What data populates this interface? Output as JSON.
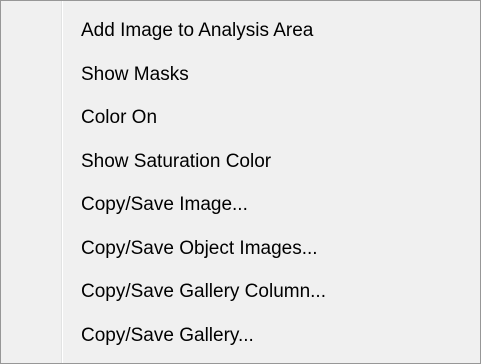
{
  "context_menu": {
    "items": [
      {
        "label": "Add Image to Analysis Area"
      },
      {
        "label": "Show Masks"
      },
      {
        "label": "Color On"
      },
      {
        "label": "Show Saturation Color"
      },
      {
        "label": "Copy/Save Image..."
      },
      {
        "label": "Copy/Save Object Images..."
      },
      {
        "label": "Copy/Save Gallery Column..."
      },
      {
        "label": "Copy/Save Gallery..."
      }
    ]
  },
  "colors": {
    "menu_background": "#f0f0f0",
    "menu_border": "#979797",
    "text": "#000000"
  }
}
